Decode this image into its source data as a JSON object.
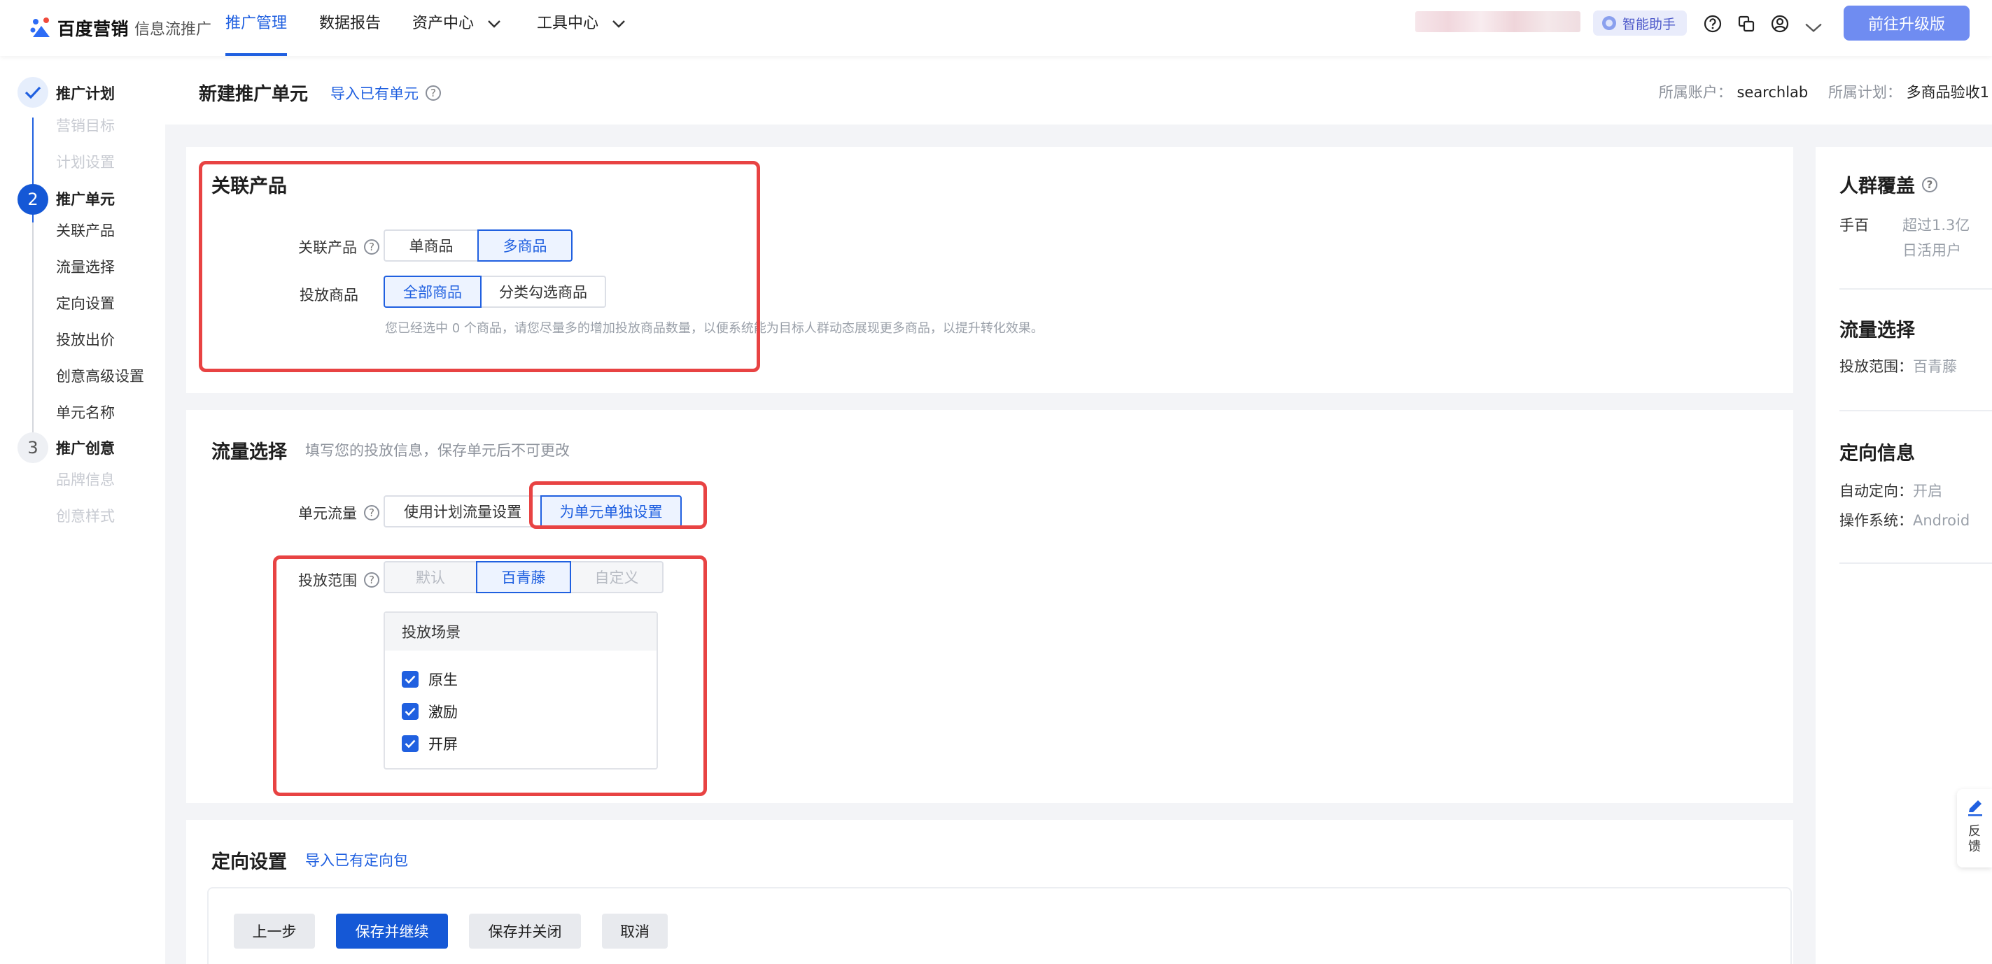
{
  "colors": {
    "accent": "#2060e0",
    "primary_button": "#1558d6",
    "highlight_box": "#e84343",
    "upgrade_button": "#6f8cf1"
  },
  "topbar": {
    "brand": "百度营销",
    "product": "信息流推广",
    "nav": [
      {
        "label": "推广管理",
        "active": true
      },
      {
        "label": "数据报告"
      },
      {
        "label": "资产中心"
      },
      {
        "label": "工具中心"
      }
    ],
    "assistant_label": "智能助手",
    "icons": [
      "help-circle-icon",
      "copy-icon",
      "user-icon",
      "chevron-down-icon"
    ],
    "upgrade_label": "前往升级版"
  },
  "sidebar": {
    "steps": [
      {
        "number": "✓",
        "title": "推广计划",
        "items": [
          "营销目标",
          "计划设置"
        ]
      },
      {
        "number": "2",
        "title": "推广单元",
        "items": [
          "关联产品",
          "流量选择",
          "定向设置",
          "投放出价",
          "创意高级设置",
          "单元名称"
        ]
      },
      {
        "number": "3",
        "title": "推广创意",
        "items": [
          "品牌信息",
          "创意样式"
        ]
      }
    ]
  },
  "header": {
    "title": "新建推广单元",
    "import_link": "导入已有单元",
    "account_label": "所属账户：",
    "account_value": "searchlab",
    "plan_label": "所属计划：",
    "plan_value": "多商品验收1"
  },
  "product_card": {
    "title": "关联产品",
    "product_label": "关联产品",
    "product_options": [
      "单商品",
      "多商品"
    ],
    "product_selected": "多商品",
    "goods_label": "投放商品",
    "goods_options": [
      "全部商品",
      "分类勾选商品"
    ],
    "goods_selected": "全部商品",
    "hint": "您已经选中 0 个商品，请您尽量多的增加投放商品数量，以便系统能为目标人群动态展现更多商品，以提升转化效果。"
  },
  "traffic_card": {
    "title": "流量选择",
    "subtitle": "填写您的投放信息，保存单元后不可更改",
    "unit_traffic_label": "单元流量",
    "unit_traffic_options": [
      "使用计划流量设置",
      "为单元单独设置"
    ],
    "unit_traffic_selected": "为单元单独设置",
    "scope_label": "投放范围",
    "scope_options": [
      "默认",
      "百青藤",
      "自定义"
    ],
    "scope_selected": "百青藤",
    "scene_title": "投放场景",
    "scenes": [
      {
        "label": "原生",
        "checked": true
      },
      {
        "label": "激励",
        "checked": true
      },
      {
        "label": "开屏",
        "checked": true
      }
    ]
  },
  "targeting_card": {
    "title": "定向设置",
    "import_link": "导入已有定向包"
  },
  "bottom_actions": {
    "prev": "上一步",
    "save_continue": "保存并继续",
    "save_close": "保存并关闭",
    "cancel": "取消"
  },
  "right_panel": {
    "audience_title": "人群覆盖",
    "audience_platform": "手百",
    "audience_value_line1": "超过1.3亿",
    "audience_value_line2": "日活用户",
    "traffic_title": "流量选择",
    "traffic_scope_label": "投放范围：",
    "traffic_scope_value": "百青藤",
    "targeting_title": "定向信息",
    "auto_target_label": "自动定向：",
    "auto_target_value": "开启",
    "os_label": "操作系统：",
    "os_value": "Android"
  },
  "feedback": {
    "label_line1": "反",
    "label_line2": "馈"
  }
}
